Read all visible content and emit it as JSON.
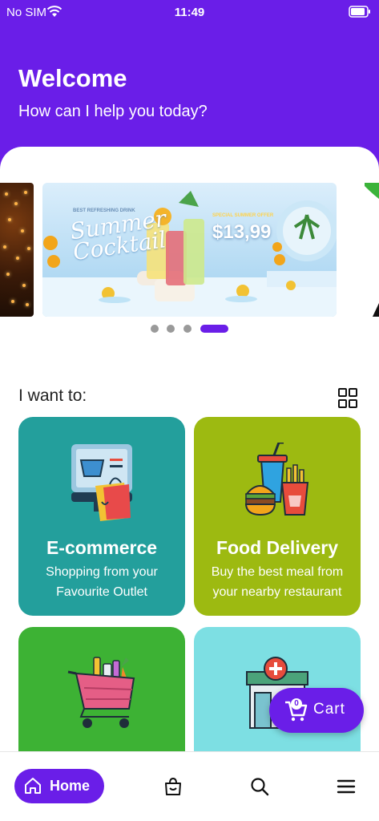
{
  "status_bar": {
    "carrier": "No SIM",
    "time": "11:49"
  },
  "header": {
    "title": "Welcome",
    "subtitle": "How can I help you today?"
  },
  "banner": {
    "small_text": "BEST REFRESHING DRINK",
    "title_line1": "Summer",
    "title_line2": "Cocktail",
    "offer_text": "SPECIAL SUMMER OFFER",
    "price": "$13,99",
    "dots_count": 4,
    "active_dot": 4
  },
  "section": {
    "title": "I want to:"
  },
  "cards": [
    {
      "title": "E-commerce",
      "desc_line1": "Shopping from your",
      "desc_line2": "Favourite Outlet",
      "color": "#239f9c"
    },
    {
      "title": "Food Delivery",
      "desc_line1": "Buy the best meal from",
      "desc_line2": "your nearby restaurant",
      "color": "#9dba11"
    },
    {
      "color": "#3db234"
    },
    {
      "color": "#7ddfe3"
    }
  ],
  "cart": {
    "count": "0",
    "label": "Cart"
  },
  "bottom_nav": {
    "home_label": "Home",
    "items": [
      "home-icon",
      "orders-bag-icon",
      "search-icon",
      "menu-icon"
    ]
  },
  "colors": {
    "accent": "#6a1ee8"
  }
}
